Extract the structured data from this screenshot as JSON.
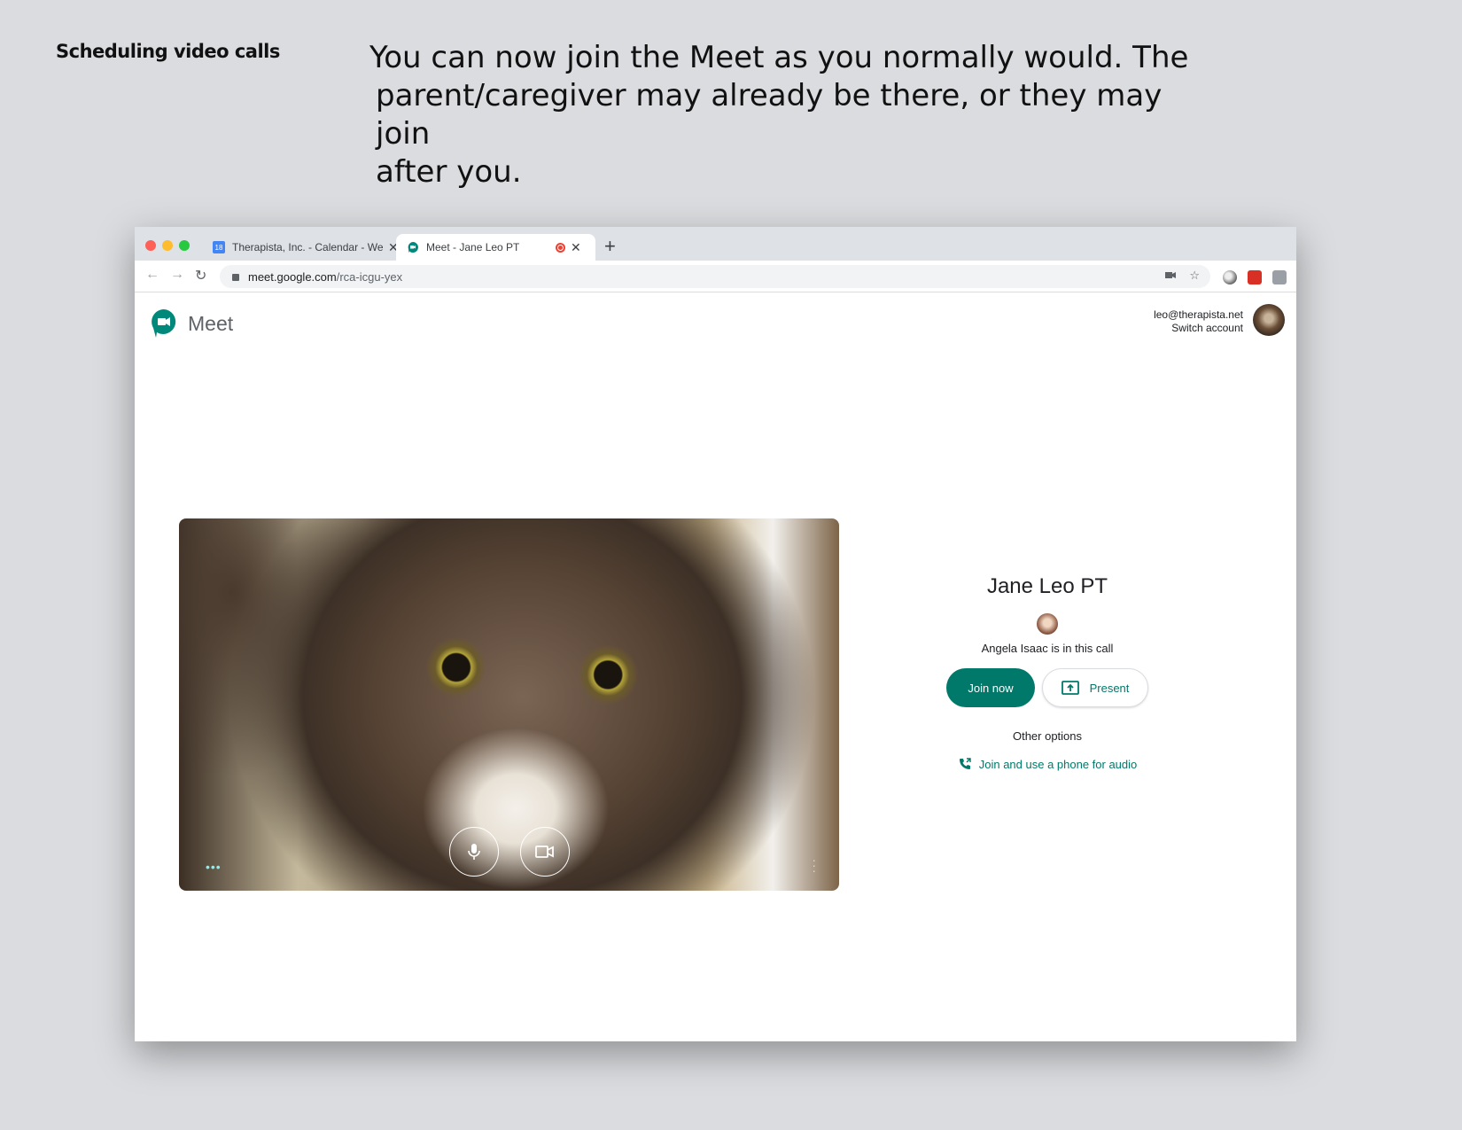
{
  "slide": {
    "section_label": "Scheduling video calls",
    "instruction_lines": [
      "You can now join the Meet as you normally would. The",
      "parent/caregiver may already be there, or they may join",
      "after you."
    ]
  },
  "browser": {
    "tabs": [
      {
        "title": "Therapista, Inc. - Calendar - Week",
        "icon": "calendar-icon",
        "icon_text": "18"
      },
      {
        "title": "Meet - Jane Leo PT",
        "icon": "meet-icon",
        "active": true
      }
    ],
    "new_tab": "+",
    "url_host": "meet.google.com",
    "url_path": "/rca-icgu-yex"
  },
  "meet": {
    "logo_text": "Meet",
    "account_email": "leo@therapista.net",
    "switch_account": "Switch account",
    "meeting_title": "Jane Leo PT",
    "participant_text": "Angela Isaac is in this call",
    "join_button": "Join now",
    "present_button": "Present",
    "other_options": "Other options",
    "phone_link": "Join and use a phone for audio"
  },
  "colors": {
    "accent": "#00796b",
    "slide_background": "#dadcdf",
    "recording": "#ea4335"
  }
}
